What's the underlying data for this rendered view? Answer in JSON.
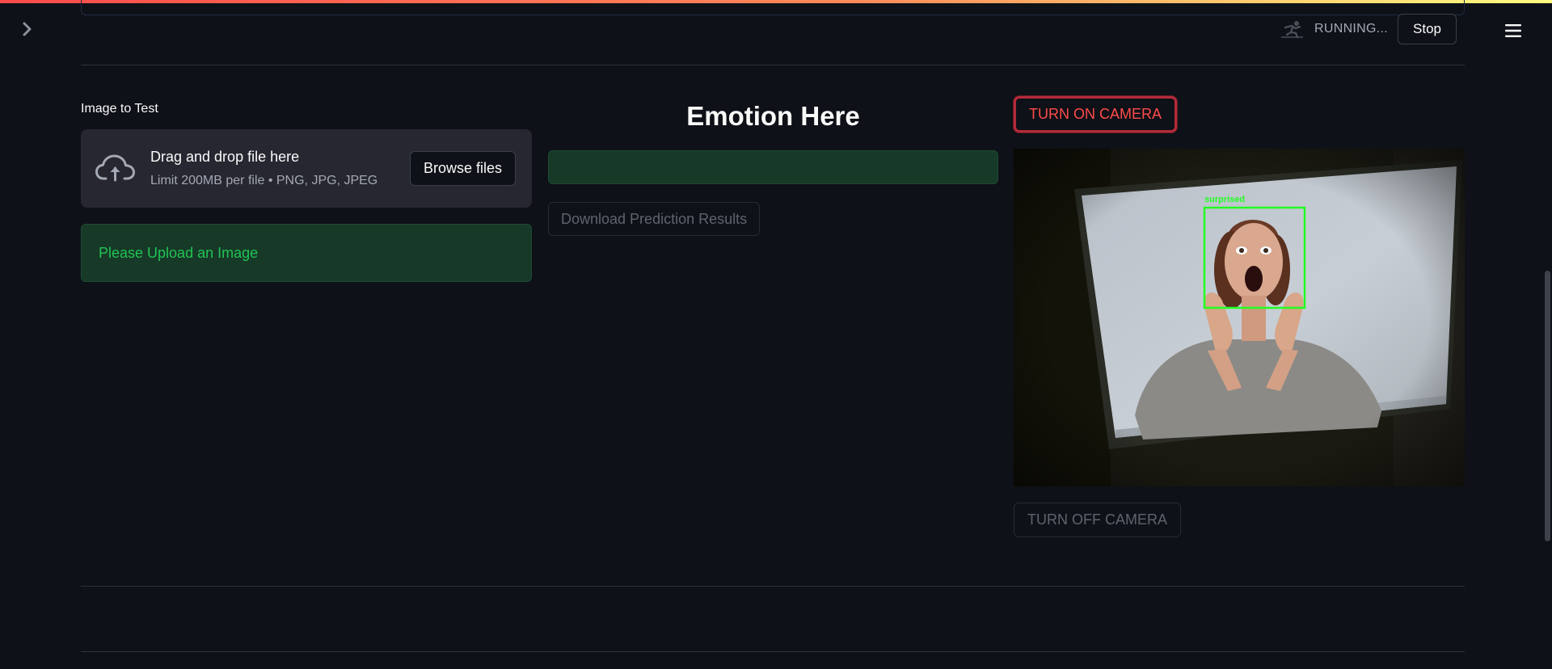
{
  "status": {
    "running_text": "RUNNING...",
    "stop_label": "Stop"
  },
  "uploader": {
    "label": "Image to Test",
    "dropzone_title": "Drag and drop file here",
    "dropzone_limit": "Limit 200MB per file • PNG, JPG, JPEG",
    "browse_label": "Browse files"
  },
  "alert": {
    "message": "Please Upload an Image"
  },
  "prediction": {
    "heading": "Emotion Here",
    "download_label": "Download Prediction Results"
  },
  "camera": {
    "on_label": "TURN ON CAMERA",
    "off_label": "TURN OFF CAMERA",
    "detection_label": "surprised"
  },
  "colors": {
    "background": "#0e1117",
    "accent": "#ff4b4b",
    "success_bg": "#173928",
    "success_text": "#21c354",
    "detection_box": "#22ff22"
  }
}
